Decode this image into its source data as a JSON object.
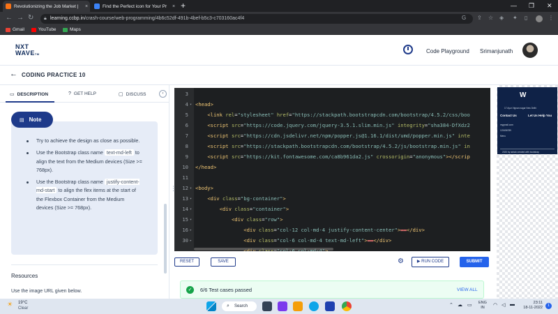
{
  "browser": {
    "tabs": [
      {
        "title": "Revolutionizing the Job Market |",
        "close": "×",
        "favicon_color": "#f97316"
      },
      {
        "title": "Find the Perfect icon for Your Pr",
        "close": "×",
        "favicon_color": "#3b82f6"
      }
    ],
    "new_tab": "+",
    "window_controls": [
      "—",
      "❐",
      "✕"
    ],
    "url_host": "learning.ccbp.in",
    "url_path": "/crash-course/web-programming/4b6c52df-491b-4bef-b5c3-c703160ac4f4",
    "bookmarks": [
      {
        "label": "Gmail",
        "color": "#ea4335"
      },
      {
        "label": "YouTube",
        "color": "#ff0000"
      },
      {
        "label": "Maps",
        "color": "#34a853"
      }
    ]
  },
  "header": {
    "logo_line1": "NXT",
    "logo_line2": "WAVE",
    "logo_tm": "TM",
    "code_playground": "Code Playground",
    "username": "Srimanjunath"
  },
  "practice": {
    "back": "←",
    "title": "CODING PRACTICE 10"
  },
  "left_tabs": {
    "description": "DESCRIPTION",
    "get_help": "GET HELP",
    "discuss": "DISCUSS",
    "collapse": "‹"
  },
  "note": {
    "badge": "Note",
    "bullet1": "Try to achieve the design as close as possible.",
    "bullet2_a": "Use the Bootstrap class name",
    "bullet2_code": "text-md-left",
    "bullet2_b": "to align the text from the Medium devices (Size >= 768px).",
    "bullet3_a": "Use the Bootstrap class name",
    "bullet3_code": "justify-content-md-start",
    "bullet3_b": "to align the flex items at the start of the Flexbox Container from the Medium devices (Size >= 768px)."
  },
  "resources": {
    "heading": "Resources",
    "description": "Use the image URL given below."
  },
  "editor": {
    "lines": [
      {
        "n": "3",
        "fold": "",
        "html": ""
      },
      {
        "n": "4",
        "fold": "▾",
        "html": "<span class='tag'>&lt;head&gt;</span>"
      },
      {
        "n": "5",
        "fold": "",
        "html": "    <span class='tag'>&lt;link</span> <span class='attr'>rel</span>=<span class='str'>\"stylesheet\"</span> <span class='attr'>href</span>=<span class='str'>\"https://stackpath.bootstrapcdn.com/bootstrap/4.5.2/css/boo</span>"
      },
      {
        "n": "6",
        "fold": "",
        "html": "    <span class='tag'>&lt;script</span> <span class='attr'>src</span>=<span class='str'>\"https://code.jquery.com/jquery-3.5.1.slim.min.js\"</span> <span class='attr'>integrity</span>=<span class='str'>\"sha384-DfXdz2</span>"
      },
      {
        "n": "7",
        "fold": "",
        "html": "    <span class='tag'>&lt;script</span> <span class='attr'>src</span>=<span class='str'>\"https://cdn.jsdelivr.net/npm/popper.js@1.16.1/dist/umd/popper.min.js\"</span> <span class='attr'>inte</span>"
      },
      {
        "n": "8",
        "fold": "",
        "html": "    <span class='tag'>&lt;script</span> <span class='attr'>src</span>=<span class='str'>\"https://stackpath.bootstrapcdn.com/bootstrap/4.5.2/js/bootstrap.min.js\"</span> <span class='attr'>in</span>"
      },
      {
        "n": "9",
        "fold": "",
        "html": "    <span class='tag'>&lt;script</span> <span class='attr'>src</span>=<span class='str'>\"https://kit.fontawesome.com/ca8b961da2.js\"</span> <span class='attr'>crossorigin</span>=<span class='str'>\"anonymous\"</span><span class='tag'>&gt;&lt;/scrip</span>"
      },
      {
        "n": "10",
        "fold": "",
        "html": "<span class='tag'>&lt;/head&gt;</span>"
      },
      {
        "n": "11",
        "fold": "",
        "html": ""
      },
      {
        "n": "12",
        "fold": "▾",
        "html": "<span class='tag'>&lt;body&gt;</span>"
      },
      {
        "n": "13",
        "fold": "▾",
        "html": "    <span class='tag'>&lt;div</span> <span class='attr'>class</span>=<span class='str'>\"bg-container\"</span><span class='tag'>&gt;</span>"
      },
      {
        "n": "14",
        "fold": "▾",
        "html": "        <span class='tag'>&lt;div</span> <span class='attr'>class</span>=<span class='str'>\"container\"</span><span class='tag'>&gt;</span>"
      },
      {
        "n": "15",
        "fold": "▾",
        "html": "            <span class='tag'>&lt;div</span> <span class='attr'>class</span>=<span class='str'>\"row\"</span><span class='tag'>&gt;</span>"
      },
      {
        "n": "16",
        "fold": "▸",
        "html": "                <span class='tag'>&lt;div</span> <span class='attr'>class</span>=<span class='str'>\"col-12 col-md-4 justify-content-center\"</span><span class='tag'>&gt;</span><span class='txt'>▬▬</span><span class='tag'>&lt;/div&gt;</span>"
      },
      {
        "n": "30",
        "fold": "▸",
        "html": "                <span class='tag'>&lt;div</span> <span class='attr'>class</span>=<span class='str'>\"col-6 col-md-4 text-md-left\"</span><span class='tag'>&gt;</span><span class='txt'>▬▬</span><span class='tag'>&lt;/div&gt;</span>"
      },
      {
        "n": "",
        "fold": "",
        "html": "                <span class='tag'>&lt;div</span> <span class='attr'>class</span>=<span class='str'>\"col-6 col-md-4\"</span><span class='tag'>&gt;</span>"
      }
    ]
  },
  "actions": {
    "reset": "RESET",
    "save": "SAVE",
    "run_code": "▶ RUN CODE",
    "submit": "SUBMIT"
  },
  "tests": {
    "status": "6/6 Test cases passed",
    "view_all": "VIEW ALL"
  },
  "preview": {
    "tagline": "17 Ayur Vignan nagar New Delhi",
    "contact_us": "Contact Us",
    "let_us_help": "Let Us Help You",
    "email": "mygmail.com",
    "phone": "123456789",
    "more": "Menu",
    "footer": "2020 by ashok created with bootstrap"
  },
  "taskbar": {
    "temp": "19°C",
    "condition": "Clear",
    "search": "Search",
    "lang_line1": "ENG",
    "lang_line2": "IN",
    "time": "23:11",
    "date": "18-11-2022",
    "notifications": "1"
  }
}
